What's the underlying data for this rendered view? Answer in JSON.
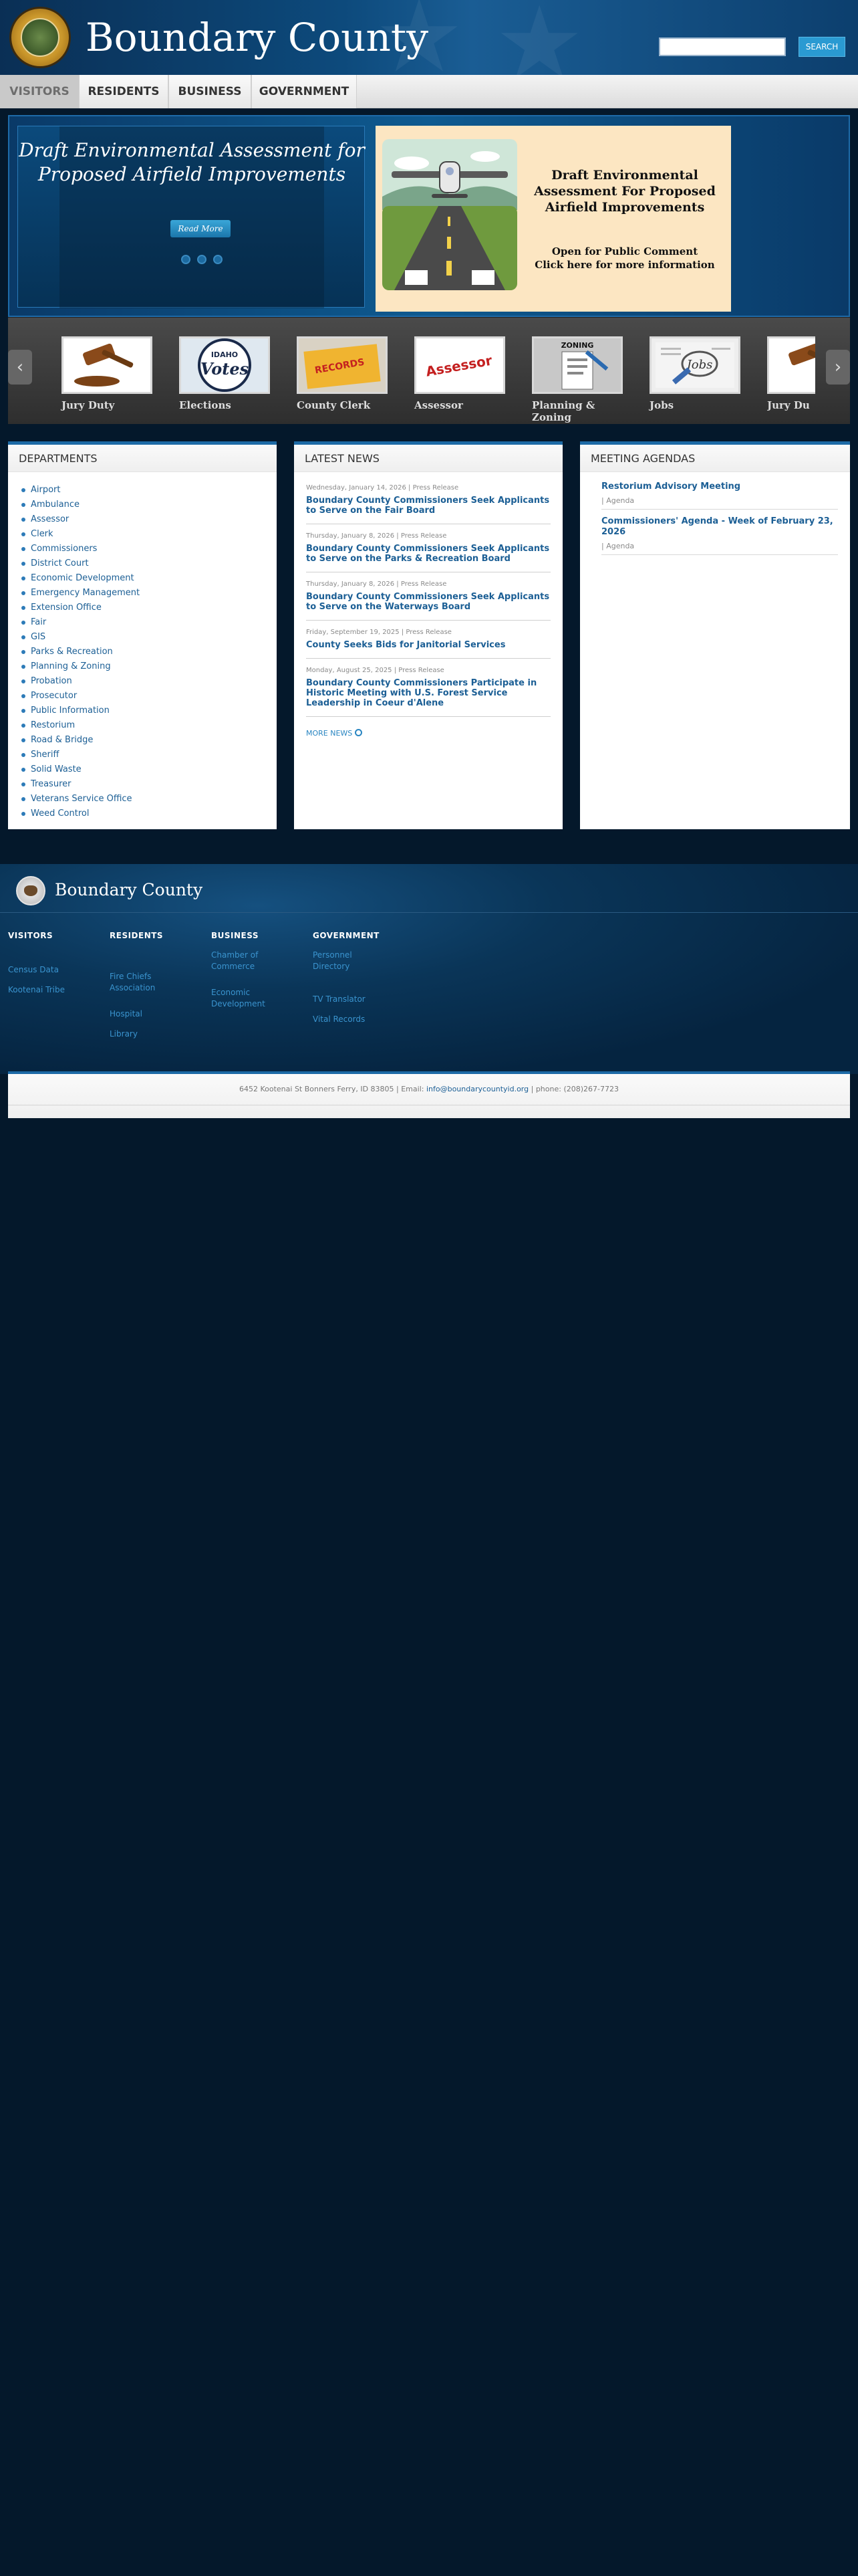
{
  "header": {
    "site_title": "Boundary County",
    "search": {
      "placeholder": "",
      "button_label": "SEARCH"
    }
  },
  "nav": {
    "items": [
      {
        "label": "VISITORS",
        "active": true
      },
      {
        "label": "RESIDENTS"
      },
      {
        "label": "BUSINESS"
      },
      {
        "label": "GOVERNMENT"
      }
    ]
  },
  "hero": {
    "headline": "Draft Environmental Assessment for Proposed Airfield Improvements",
    "read_more_label": "Read More",
    "slide_count": 3,
    "image": {
      "title": "Draft Environmental Assessment For Proposed Airfield Improvements",
      "subtitle_line1": "Open for Public Comment",
      "subtitle_line2": "Click here for more information",
      "background_color": "#fce6c2"
    }
  },
  "carousel": {
    "items": [
      {
        "label": "Jury Duty",
        "icon": "gavel-icon"
      },
      {
        "label": "Elections",
        "icon": "idaho-votes-icon",
        "thumb_text_top": "IDAHO",
        "thumb_text_main": "Votes"
      },
      {
        "label": "County Clerk",
        "icon": "records-folder-icon",
        "thumb_text_main": "RECORDS"
      },
      {
        "label": "Assessor",
        "icon": "assessor-stamp-icon",
        "thumb_text_main": "Assessor"
      },
      {
        "label": "Planning & Zoning",
        "icon": "zoning-clipboard-icon",
        "thumb_text_main": "ZONING"
      },
      {
        "label": "Jobs",
        "icon": "jobs-newspaper-icon",
        "thumb_text_main": "Jobs"
      },
      {
        "label": "Jury Du",
        "icon": "gavel-icon"
      }
    ]
  },
  "departments": {
    "heading": "DEPARTMENTS",
    "items": [
      "Airport",
      "Ambulance",
      "Assessor",
      "Clerk",
      "Commissioners",
      "District Court",
      "Economic Development",
      "Emergency Management",
      "Extension Office",
      "Fair",
      "GIS",
      "Parks & Recreation",
      "Planning & Zoning",
      "Probation",
      "Prosecutor",
      "Public Information",
      "Restorium",
      "Road & Bridge",
      "Sheriff",
      "Solid Waste",
      "Treasurer",
      "Veterans Service Office",
      "Weed Control"
    ]
  },
  "news": {
    "heading": "LATEST NEWS",
    "items": [
      {
        "meta": "Wednesday, January 14, 2026 | Press Release",
        "title": "Boundary County Commissioners Seek Applicants to Serve on the Fair Board"
      },
      {
        "meta": "Thursday, January 8, 2026 | Press Release",
        "title": "Boundary County Commissioners Seek Applicants to Serve on the Parks & Recreation Board"
      },
      {
        "meta": "Thursday, January 8, 2026 | Press Release",
        "title": "Boundary County Commissioners Seek Applicants to Serve on the Waterways Board"
      },
      {
        "meta": "Friday, September 19, 2025 | Press Release",
        "title": "County Seeks Bids for Janitorial Services"
      },
      {
        "meta": "Monday, August 25, 2025 | Press Release",
        "title": "Boundary County Commissioners Participate in Historic Meeting with U.S. Forest Service Leadership in Coeur d'Alene"
      }
    ],
    "more_label": "MORE NEWS"
  },
  "agendas": {
    "heading": "MEETING AGENDAS",
    "items": [
      {
        "title": "Restorium Advisory Meeting",
        "sub": "| Agenda"
      },
      {
        "title": "Commissioners' Agenda - Week of February 23, 2026",
        "sub": "| Agenda"
      }
    ]
  },
  "footer": {
    "title": "Boundary County",
    "columns": [
      {
        "heading": "VISITORS",
        "links": [
          "Census Data",
          "Kootenai Tribe"
        ]
      },
      {
        "heading": "RESIDENTS",
        "links": [
          "Fire Chiefs Association",
          "Hospital",
          "Library"
        ]
      },
      {
        "heading": "BUSINESS",
        "links": [
          "Chamber of Commerce",
          "Economic Development"
        ]
      },
      {
        "heading": "GOVERNMENT",
        "links": [
          "Personnel Directory",
          "TV Translator",
          "Vital Records"
        ]
      }
    ],
    "address_prefix": "6452 Kootenai St Bonners Ferry, ID 83805 | Email: ",
    "email": "info@boundarycountyid.org",
    "address_suffix": " | phone: (208)267-7723"
  },
  "colors": {
    "accent": "#1d6aa6",
    "link": "#1c5f95",
    "page_bg": "#04182b"
  }
}
